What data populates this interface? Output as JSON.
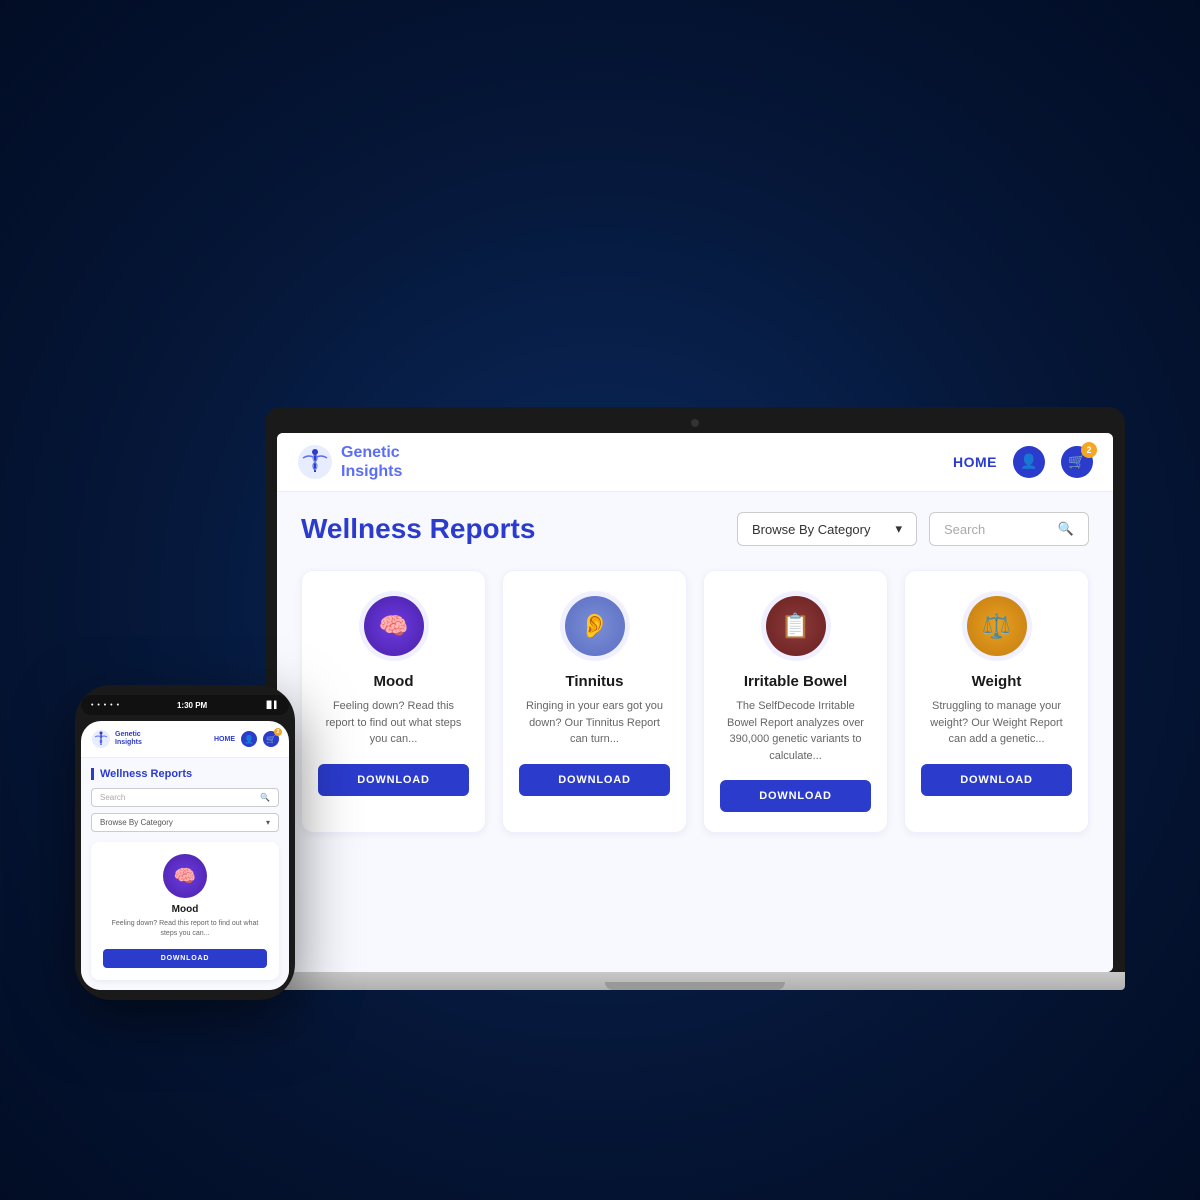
{
  "app": {
    "logo_text_line1": "Genetic",
    "logo_text_line2": "Insights",
    "nav_home": "HOME",
    "cart_badge": "2",
    "page_title": "Wellness Reports",
    "category_placeholder": "Browse By Category",
    "search_placeholder": "Search"
  },
  "phone": {
    "status_left": "• • • • •",
    "status_time": "1:30 PM",
    "status_right": "▐▌▌",
    "page_title": "Wellness Reports",
    "search_placeholder": "Search",
    "category_placeholder": "Browse By Category",
    "card": {
      "title": "Mood",
      "desc": "Feeling down? Read this report to find out what steps you can...",
      "download_label": "DOWNLOAD"
    }
  },
  "reports": [
    {
      "title": "Mood",
      "desc": "Feeling down? Read this report to find out what steps you can...",
      "icon": "🧠",
      "icon_class": "icon-mood",
      "download_label": "DOWNLOAD"
    },
    {
      "title": "Tinnitus",
      "desc": "Ringing in your ears got you down? Our Tinnitus Report can turn...",
      "icon": "👂",
      "icon_class": "icon-tinnitus",
      "download_label": "DOWNLOAD"
    },
    {
      "title": "Irritable Bowel",
      "desc": "The SelfDecode Irritable Bowel Report analyzes over 390,000 genetic variants to calculate...",
      "icon": "📋",
      "icon_class": "icon-bowel",
      "download_label": "DOWNLOAD"
    },
    {
      "title": "Weight",
      "desc": "Struggling to manage your weight? Our Weight Report can add a genetic...",
      "icon": "⚖️",
      "icon_class": "icon-weight",
      "download_label": "DOWNLOAD"
    }
  ]
}
